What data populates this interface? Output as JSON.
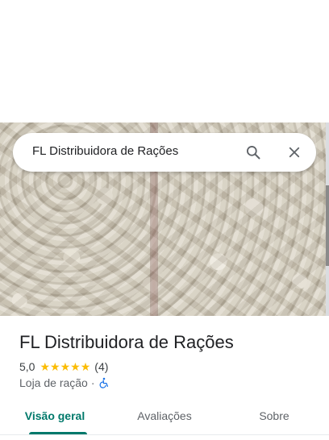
{
  "search": {
    "query": "FL Distribuidora de Rações",
    "search_icon": "search-icon",
    "close_icon": "close-icon"
  },
  "hero": {
    "description_icon": "place-photo"
  },
  "place": {
    "name": "FL Distribuidora de Rações",
    "rating_value": "5,0",
    "stars_filled": 5,
    "stars_total": 5,
    "review_count": "(4)",
    "category": "Loja de ração",
    "separator": "·",
    "accessibility_icon": "wheelchair-icon"
  },
  "tabs": [
    {
      "label": "Visão geral",
      "active": true
    },
    {
      "label": "Avaliações",
      "active": false
    },
    {
      "label": "Sobre",
      "active": false
    }
  ],
  "colors": {
    "accent": "#00796b",
    "star": "#fbbc04",
    "accessibility": "#1a73e8"
  }
}
